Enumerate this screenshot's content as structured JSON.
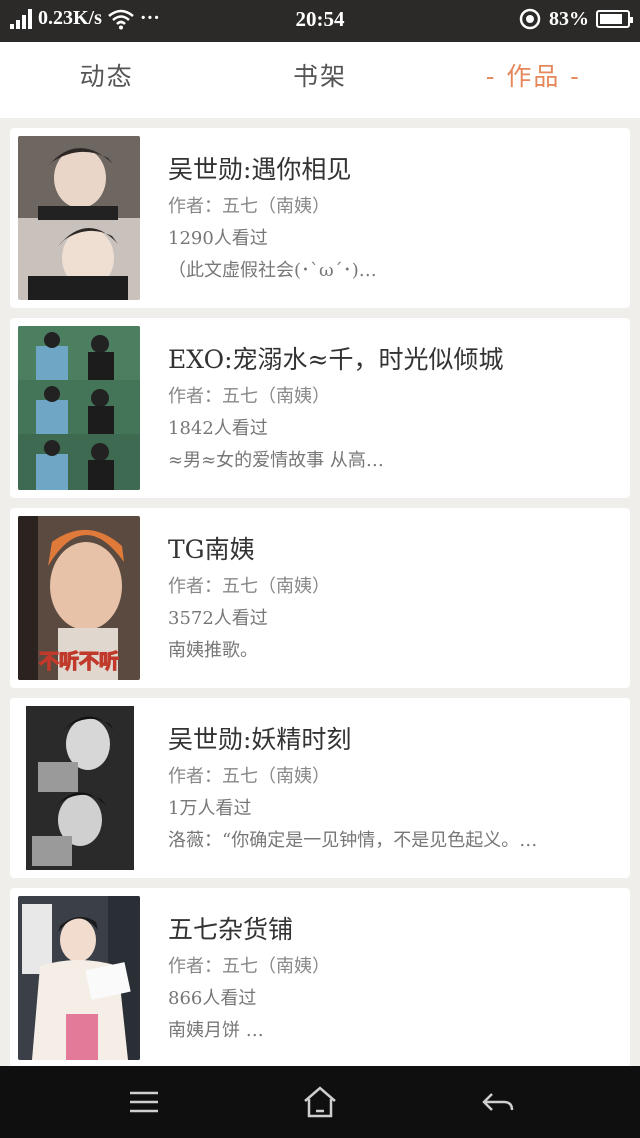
{
  "status_bar": {
    "speed": "0.23K/s",
    "dots": "···",
    "time": "20:54",
    "battery_pct": "83%",
    "battery_level": 0.83
  },
  "tabs": [
    {
      "label": "动态",
      "active": false
    },
    {
      "label": "书架",
      "active": false
    },
    {
      "label": "作品",
      "active": true
    }
  ],
  "works": [
    {
      "title": "吴世勋:遇你相见",
      "author": "作者：五七（南姨）",
      "views": "1290人看过",
      "desc": "（此文虚假社会(･`ω´･)…",
      "thumb_icon": "portrait-photo"
    },
    {
      "title": "EXO:宠溺水≈千，时光似倾城",
      "author": "作者：五七（南姨）",
      "views": "1842人看过",
      "desc": "≈男≈女的爱情故事 从高…",
      "thumb_icon": "couple-photo"
    },
    {
      "title": "TG南姨",
      "author": "作者：五七（南姨）",
      "views": "3572人看过",
      "desc": "南姨推歌。",
      "thumb_caption": "不听不听",
      "thumb_icon": "portrait-photo"
    },
    {
      "title": "吴世勋:妖精时刻",
      "author": "作者：五七（南姨）",
      "views": "1万人看过",
      "desc": "洛薇：“你确定是一见钟情，不是见色起义。…",
      "thumb_icon": "portrait-photo"
    },
    {
      "title": "五七杂货铺",
      "author": "作者：五七（南姨）",
      "views": "866人看过",
      "desc": "南姨月饼 …",
      "thumb_icon": "reading-photo"
    }
  ],
  "nav_bar": {
    "menu_icon": "menu-icon",
    "home_icon": "home-icon",
    "back_icon": "back-icon"
  }
}
